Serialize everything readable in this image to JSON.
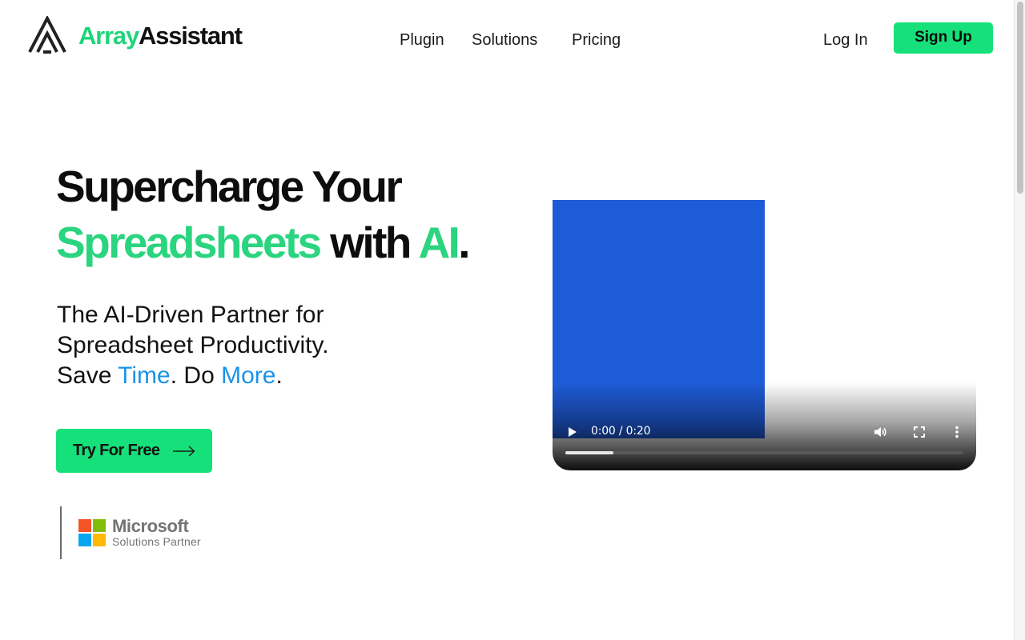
{
  "brand": {
    "name_part1": "Array",
    "name_part2": "Assistant",
    "logo_icon": "array-assistant-logo-icon",
    "accent_color": "#16e07a"
  },
  "nav": {
    "items": [
      {
        "label": "Plugin"
      },
      {
        "label": "Solutions"
      },
      {
        "label": "Pricing"
      }
    ],
    "login_label": "Log In",
    "signup_label": "Sign Up"
  },
  "hero": {
    "headline_line1": "Supercharge Your",
    "headline_word_spreadsheets": "Spreadsheets",
    "headline_word_with": " with ",
    "headline_word_ai": "AI",
    "headline_period": ".",
    "subhead_line1": "The AI-Driven Partner for",
    "subhead_line2": "Spreadsheet Productivity.",
    "subhead_save": "Save ",
    "subhead_time": "Time",
    "subhead_do": ". Do ",
    "subhead_more": "More",
    "subhead_end": ".",
    "cta_label": "Try For Free",
    "cta_icon": "arrow-right-icon",
    "green_color": "#2bd47f",
    "blue_color": "#1a93e8"
  },
  "partner": {
    "name": "Microsoft",
    "subtitle": "Solutions Partner",
    "logo_colors": [
      "#f35325",
      "#81bc06",
      "#05a6f0",
      "#ffba08"
    ]
  },
  "video": {
    "time_display": "0:00 / 0:20",
    "progress_fraction": 0.12,
    "controls": [
      "play-icon",
      "volume-icon",
      "fullscreen-icon",
      "more-vertical-icon"
    ]
  }
}
